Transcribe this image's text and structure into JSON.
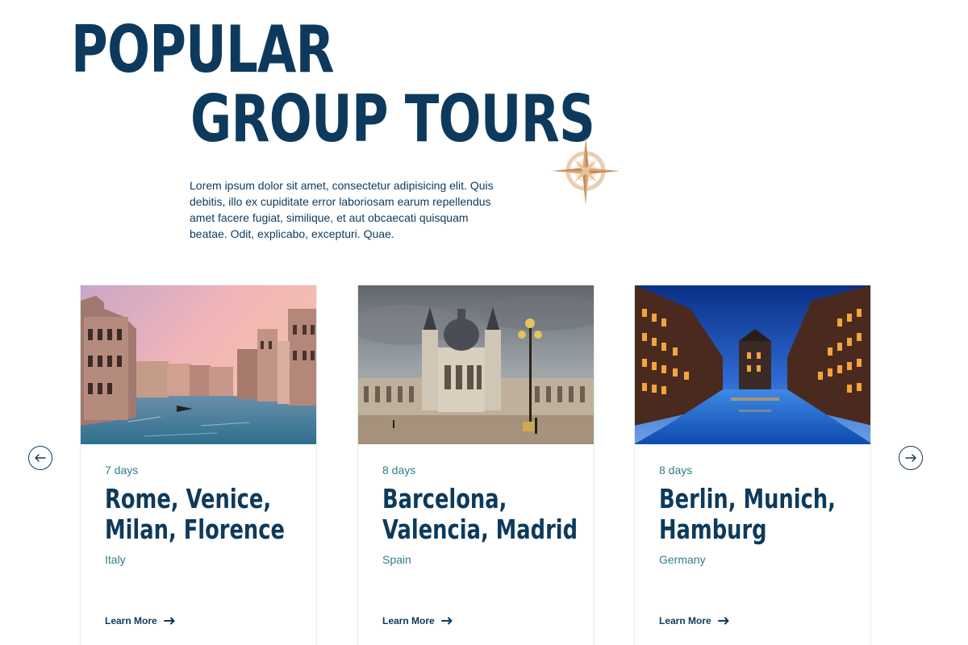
{
  "header": {
    "title_line1": "Popular",
    "title_line2": "Group Tours",
    "intro": "Lorem ipsum dolor sit amet, consectetur adipisicing elit. Quis debitis, illo ex cupiditate error laboriosam earum repellendus amet facere fugiat, similique, et aut obcaecati quisquam beatae. Odit, explicabo, excepturi. Quae."
  },
  "decor": {
    "compass_icon": "compass-rose-icon"
  },
  "carousel": {
    "prev_icon": "arrow-left-icon",
    "next_icon": "arrow-right-icon"
  },
  "tours": [
    {
      "days": "7 days",
      "title": "Rome, Venice,\nMilan, Florence",
      "country": "Italy",
      "cta": "Learn More",
      "image": "venice-canal-photo"
    },
    {
      "days": "8 days",
      "title": "Barcelona,\nValencia, Madrid",
      "country": "Spain",
      "cta": "Learn More",
      "image": "madrid-cathedral-photo"
    },
    {
      "days": "8 days",
      "title": "Berlin, Munich,\nHamburg",
      "country": "Germany",
      "cta": "Learn More",
      "image": "hamburg-speicherstadt-photo"
    }
  ],
  "colors": {
    "primary": "#0d3a5c",
    "accent": "#2f7f86",
    "compass": "#d9a877"
  }
}
